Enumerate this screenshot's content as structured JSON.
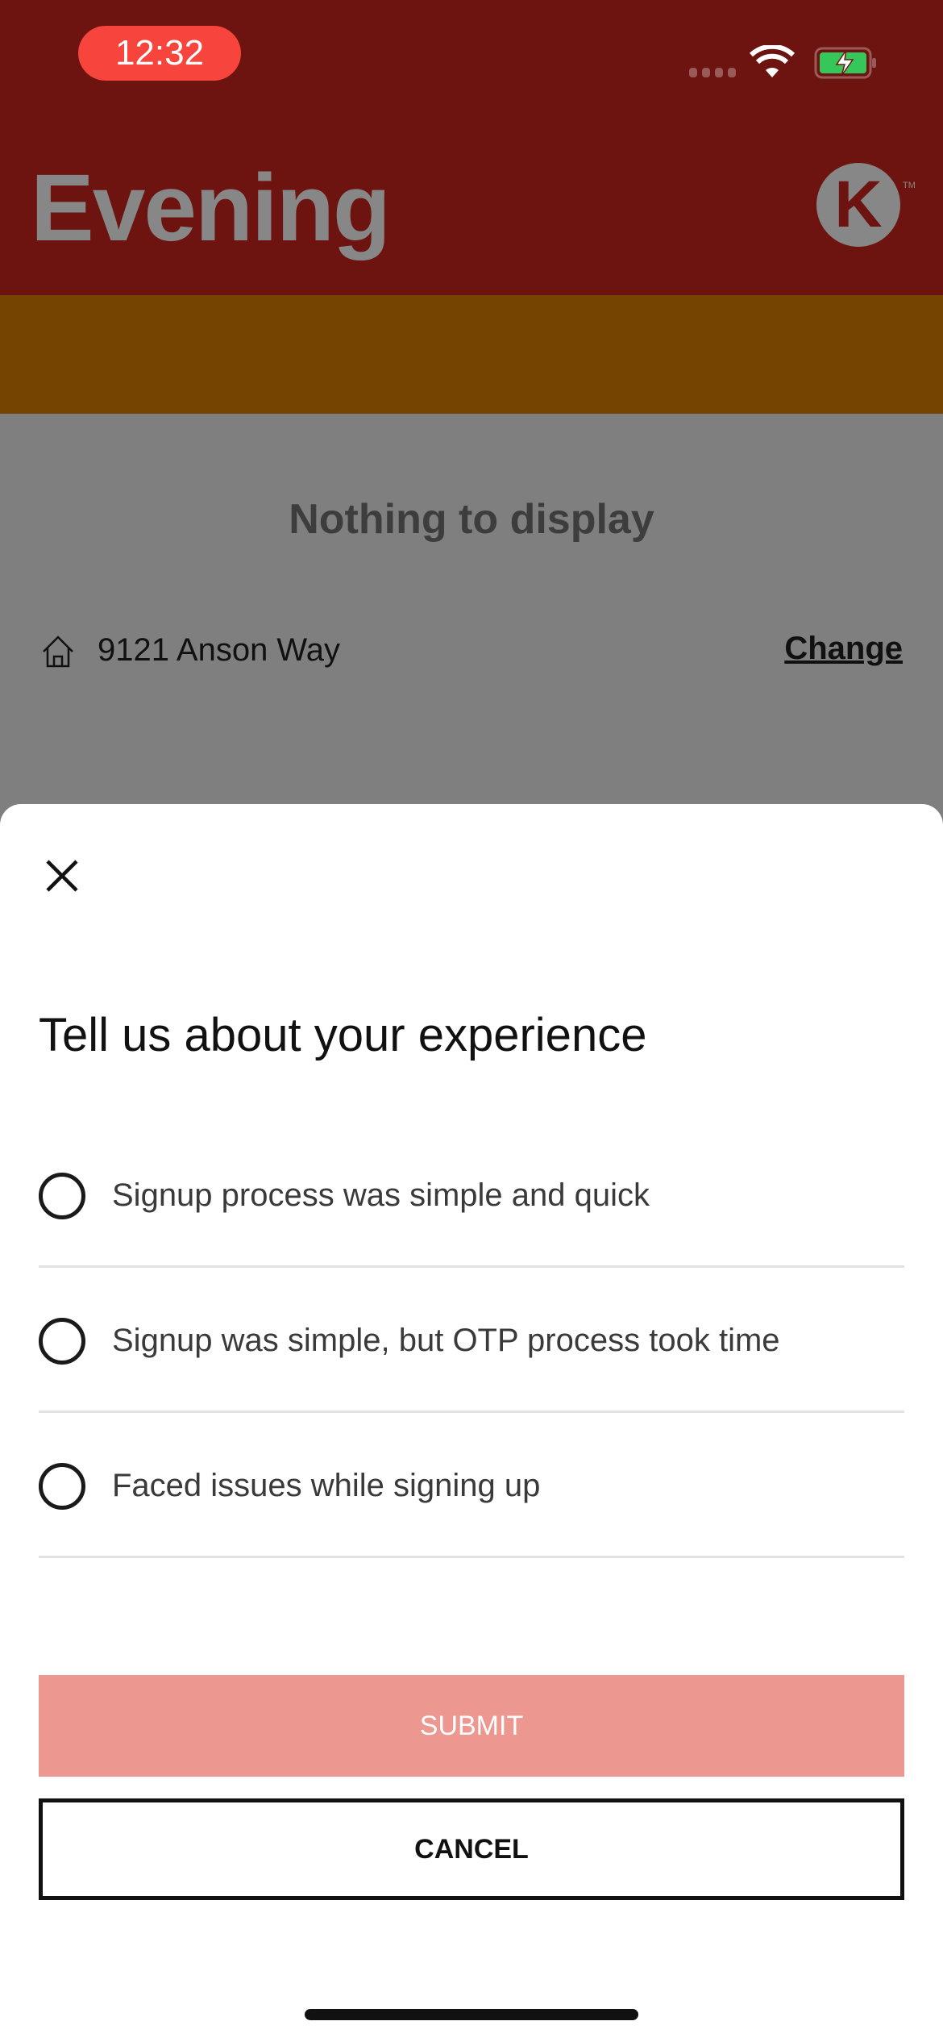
{
  "status_bar": {
    "time": "12:32"
  },
  "header": {
    "title": "Evening",
    "logo_letter": "K",
    "logo_tm": "TM"
  },
  "address_bar": {
    "address": "9121 Anson Way",
    "change_label": "Change"
  },
  "main": {
    "empty_text": "Nothing to display"
  },
  "sheet": {
    "title": "Tell us about your experience",
    "options": [
      {
        "label": "Signup process was simple and quick"
      },
      {
        "label": "Signup was simple, but OTP process took time"
      },
      {
        "label": "Faced issues while signing up"
      }
    ],
    "submit_label": "SUBMIT",
    "cancel_label": "CANCEL"
  },
  "colors": {
    "header": "#6e1410",
    "address_bar": "#744400",
    "submit": "#ec9790",
    "time_pill": "#f7443c"
  }
}
